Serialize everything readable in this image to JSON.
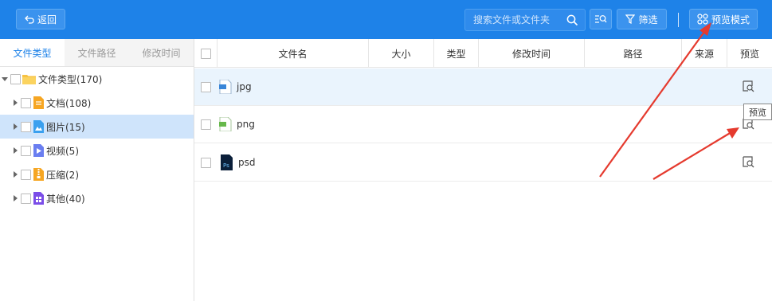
{
  "topbar": {
    "back_label": "返回",
    "search_placeholder": "搜索文件或文件夹",
    "filter_label": "筛选",
    "preview_mode_label": "预览模式"
  },
  "sidebar": {
    "tabs": [
      {
        "label": "文件类型",
        "active": true
      },
      {
        "label": "文件路径",
        "active": false
      },
      {
        "label": "修改时间",
        "active": false
      }
    ],
    "tree": [
      {
        "label": "文件类型(170)",
        "icon": "folder-icon",
        "expanded": true
      },
      {
        "label": "文档(108)",
        "icon": "document-icon"
      },
      {
        "label": "图片(15)",
        "icon": "image-icon",
        "selected": true
      },
      {
        "label": "视频(5)",
        "icon": "video-icon"
      },
      {
        "label": "压缩(2)",
        "icon": "archive-icon"
      },
      {
        "label": "其他(40)",
        "icon": "other-icon"
      }
    ]
  },
  "table": {
    "columns": [
      "文件名",
      "大小",
      "类型",
      "修改时间",
      "路径",
      "来源",
      "预览"
    ],
    "rows": [
      {
        "name": "jpg",
        "icon": "jpg-file-icon"
      },
      {
        "name": "png",
        "icon": "png-file-icon"
      },
      {
        "name": "psd",
        "icon": "psd-file-icon"
      }
    ]
  },
  "tooltip": "预览",
  "colors": {
    "accent": "#1e82e8",
    "arrow": "#e53a2e",
    "selected_row": "#cfe4fb"
  }
}
